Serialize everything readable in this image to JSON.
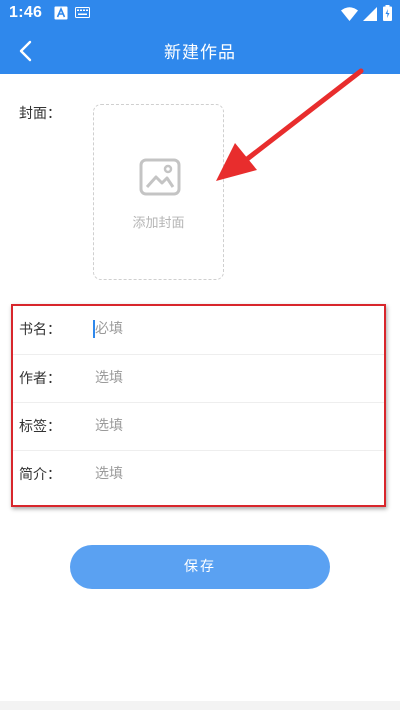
{
  "status_bar": {
    "time": "1:46"
  },
  "header": {
    "title": "新建作品"
  },
  "cover": {
    "label": "封面：",
    "add_text": "添加封面"
  },
  "fields": [
    {
      "label": "书名：",
      "placeholder": "必填"
    },
    {
      "label": "作者：",
      "placeholder": "选填"
    },
    {
      "label": "标签：",
      "placeholder": "选填"
    },
    {
      "label": "简介：",
      "placeholder": "选填"
    }
  ],
  "save_button": {
    "label": "保存"
  },
  "colors": {
    "primary": "#2f88ec",
    "button": "#5aa1f2",
    "highlight": "#d8262c"
  }
}
